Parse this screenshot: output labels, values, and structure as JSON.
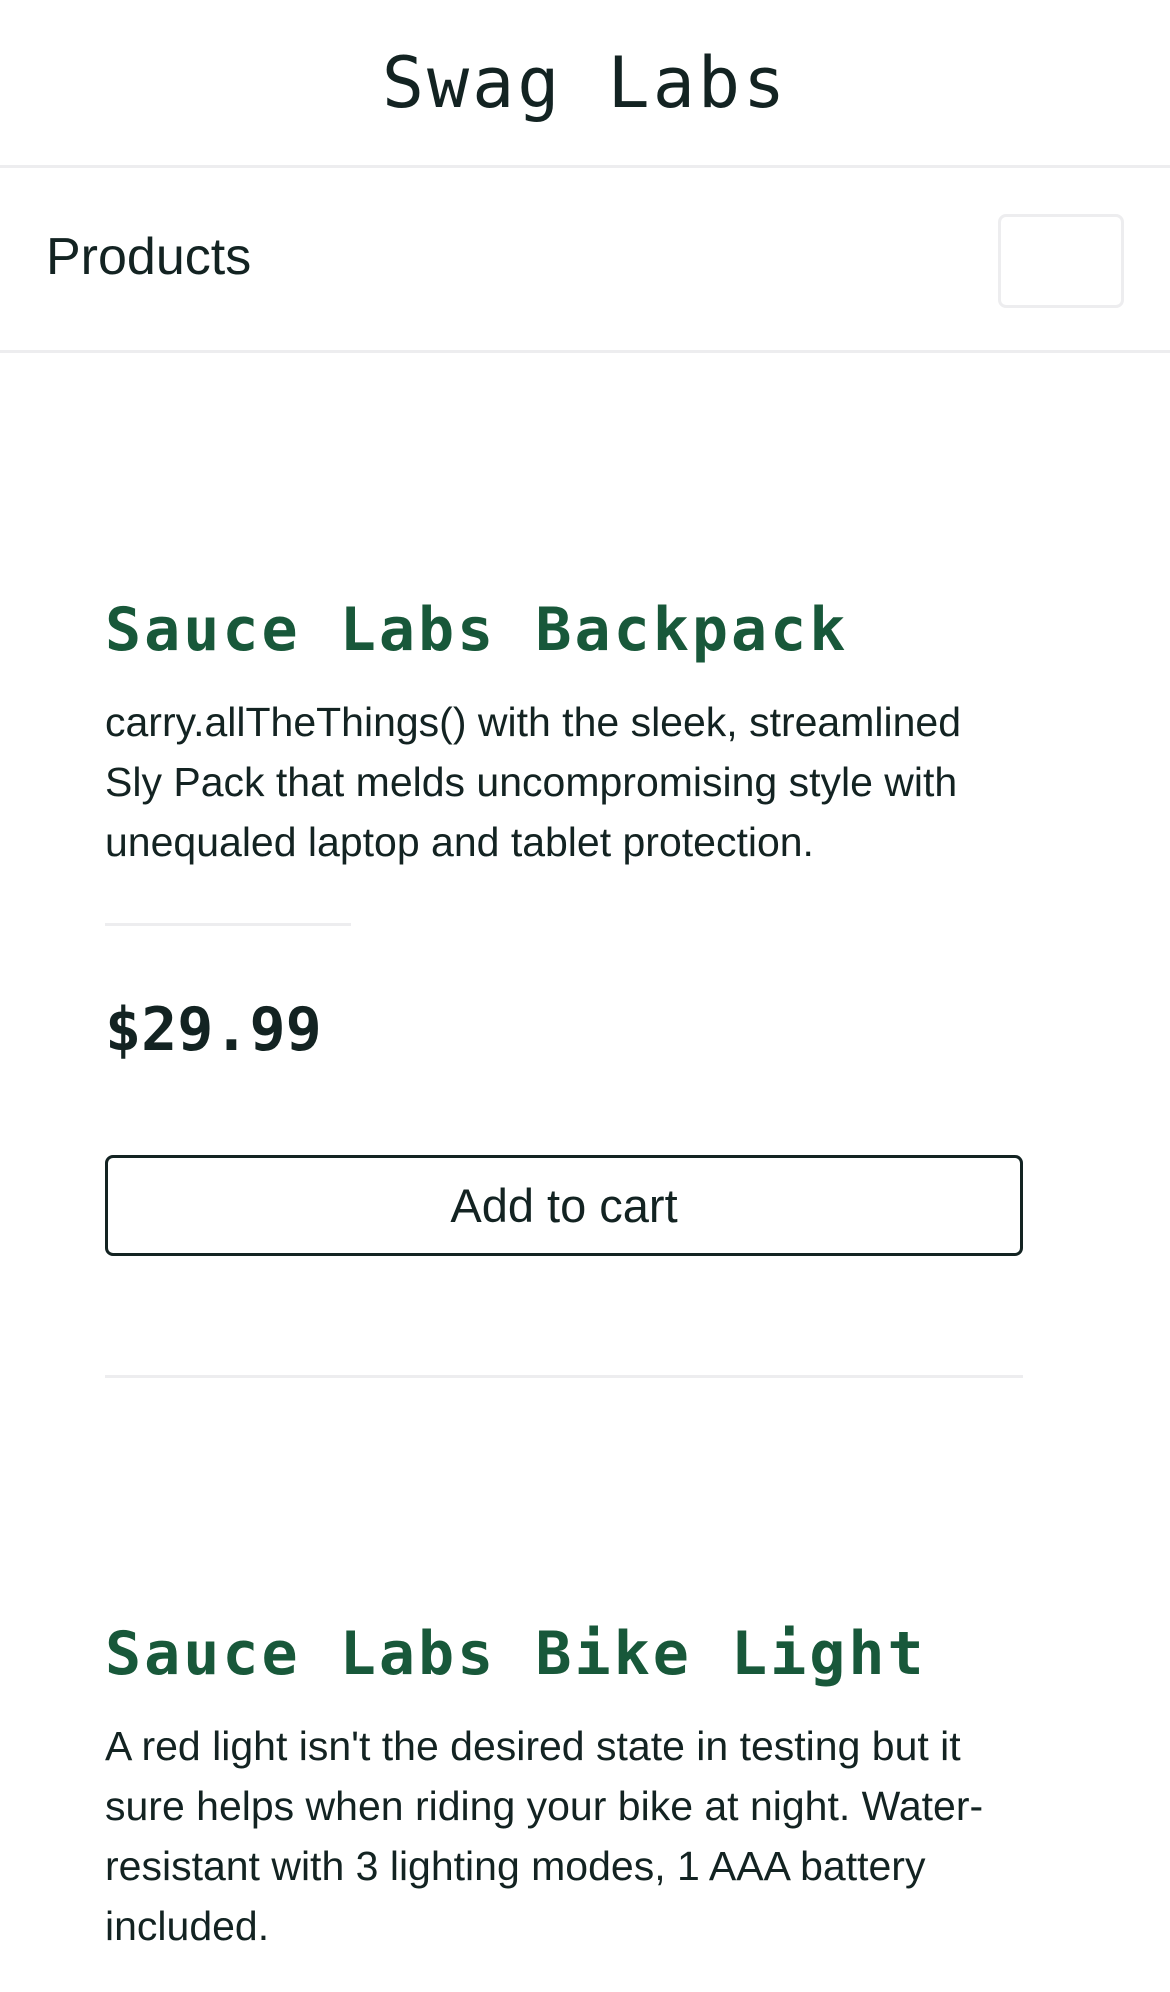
{
  "app": {
    "title": "Swag Labs"
  },
  "header": {
    "page_title": "Products"
  },
  "items": [
    {
      "name": "Sauce Labs Backpack",
      "description": "carry.allTheThings() with the sleek, streamlined Sly Pack that melds uncompromising style with unequaled laptop and tablet protection.",
      "price": "$29.99",
      "button_label": "Add to cart"
    },
    {
      "name": "Sauce Labs Bike Light",
      "description": "A red light isn't the desired state in testing but it sure helps when riding your bike at night. Water-resistant with 3 lighting modes, 1 AAA battery included."
    }
  ],
  "colors": {
    "item_name": "#18583a",
    "text": "#132322",
    "divider": "#ededef"
  }
}
